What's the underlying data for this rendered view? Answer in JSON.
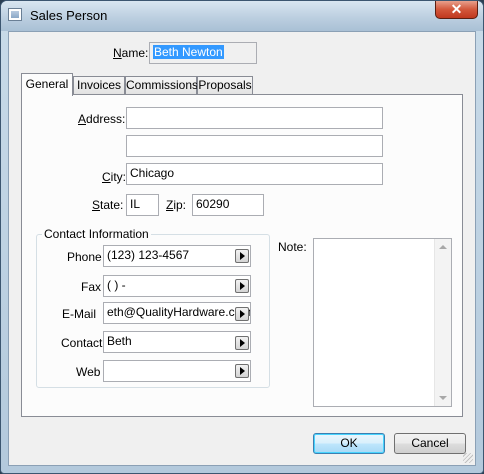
{
  "window": {
    "title": "Sales Person",
    "close_symbol": "✕"
  },
  "name_field": {
    "label_ul": "N",
    "label_rest": "ame:",
    "value": "Beth Newton"
  },
  "tabs": [
    {
      "label": "General",
      "active": true
    },
    {
      "label": "Invoices",
      "active": false
    },
    {
      "label": "Commissions",
      "active": false
    },
    {
      "label": "Proposals",
      "active": false
    }
  ],
  "general": {
    "address": {
      "label_ul": "A",
      "label_rest": "ddress:",
      "line1": "",
      "line2": ""
    },
    "city": {
      "label_ul": "C",
      "label_rest": "ity:",
      "value": "Chicago"
    },
    "state": {
      "label_ul": "S",
      "label_rest": "tate:",
      "value": "IL"
    },
    "zip": {
      "label_ul": "Z",
      "label_rest": "ip:",
      "value": "60290"
    }
  },
  "contact": {
    "group_title": "Contact Information",
    "phone": {
      "label": "Phone",
      "value": "(123) 123-4567"
    },
    "fax": {
      "label": "Fax",
      "value": "(    )      -"
    },
    "email": {
      "label": "E-Mail",
      "value": "eth@QualityHardware.com"
    },
    "contact": {
      "label": "Contact",
      "value": "Beth"
    },
    "web": {
      "label": "Web",
      "value": ""
    }
  },
  "note": {
    "label": "Note:",
    "value": ""
  },
  "buttons": {
    "ok": "OK",
    "cancel": "Cancel"
  },
  "icons": {
    "app": "window-icon",
    "close": "close-icon",
    "expand": "arrow-right-icon"
  }
}
